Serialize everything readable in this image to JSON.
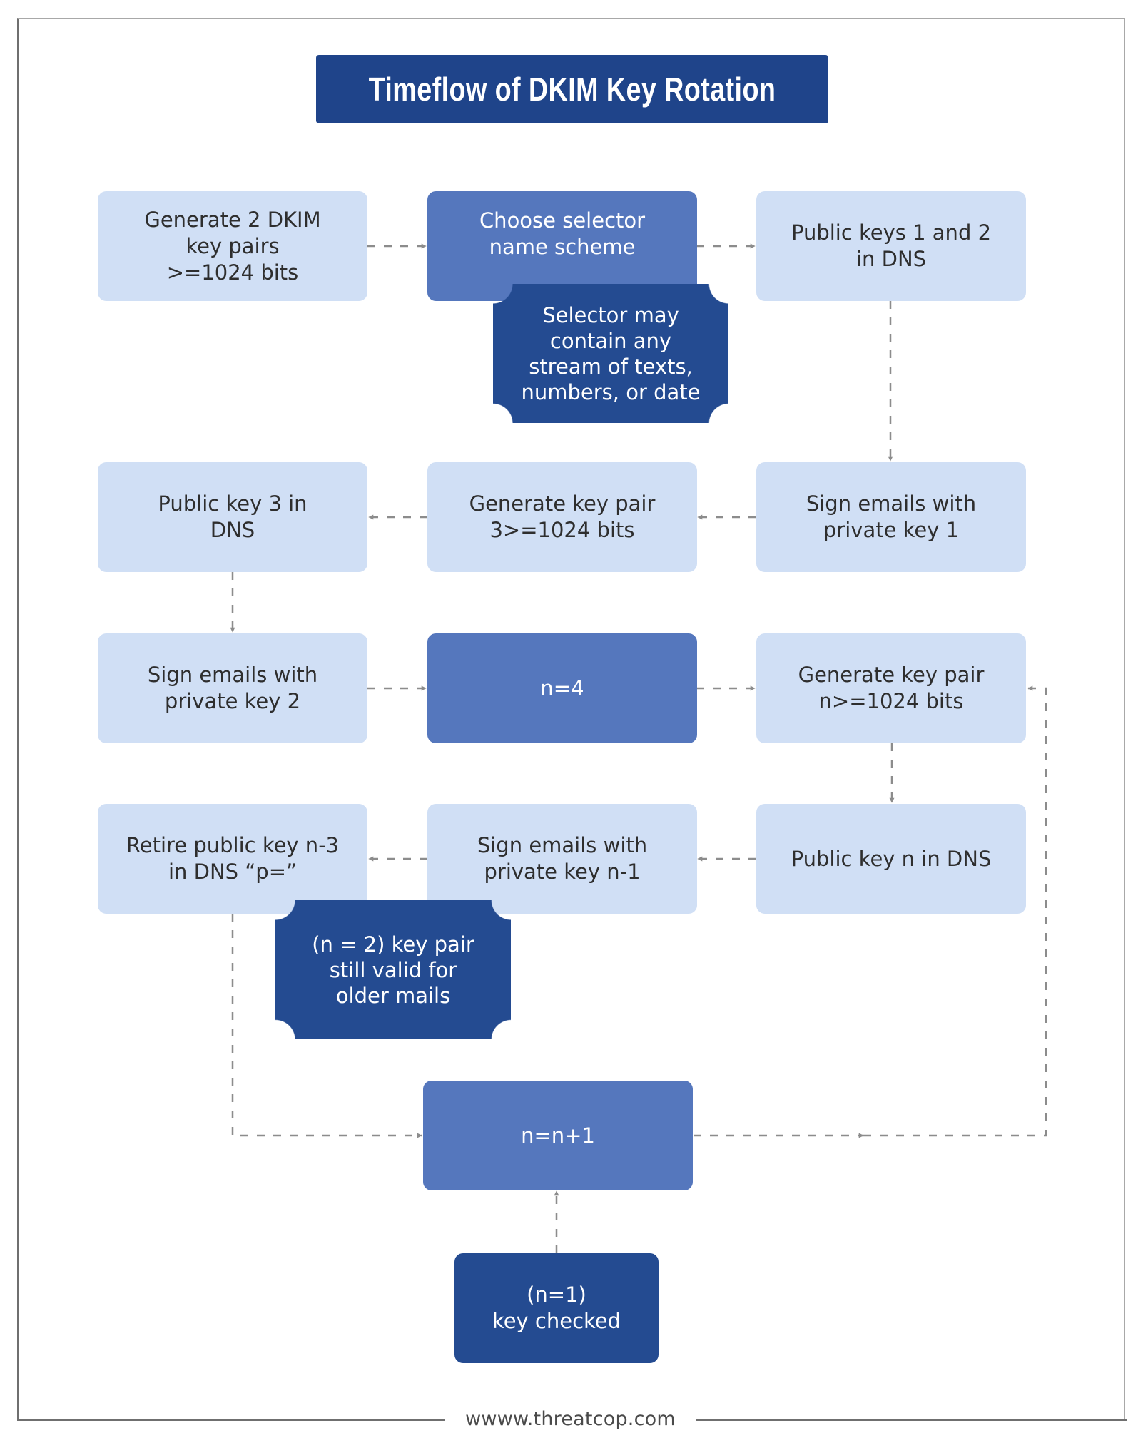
{
  "title": "Timeflow of DKIM Key Rotation",
  "nodes": {
    "gen_two_pairs": "Generate 2 DKIM\nkey pairs\n>=1024 bits",
    "choose_selector": "Choose selector\nname scheme",
    "pub_keys_1_2": "Public keys 1 and 2\nin DNS",
    "sign_key_1": "Sign emails with\nprivate key 1",
    "gen_pair_3": "Generate key pair\n3>=1024 bits",
    "pub_key_3": "Public key 3 in\nDNS",
    "sign_key_2": "Sign emails with\nprivate key 2",
    "n_equals_4": "n=4",
    "gen_pair_n": "Generate key pair\nn>=1024 bits",
    "pub_key_n": "Public key n in DNS",
    "sign_key_n_minus_1": "Sign emails with\nprivate key n-1",
    "retire_key": "Retire public key n-3\nin DNS “p=”",
    "increment": "n=n+1",
    "key_checked": "(n=1)\nkey checked"
  },
  "callouts": {
    "selector_note": "Selector may\ncontain any\nstream of texts,\nnumbers, or date",
    "valid_note": "(n = 2) key pair\nstill valid for\nolder mails"
  },
  "footer": "wwww.threatcop.com",
  "colors": {
    "title_bg": "#1f448a",
    "light_node": "#d0dff5",
    "mid_node": "#5577bd",
    "dark_node": "#244b91",
    "connector": "#8c8c8c"
  }
}
